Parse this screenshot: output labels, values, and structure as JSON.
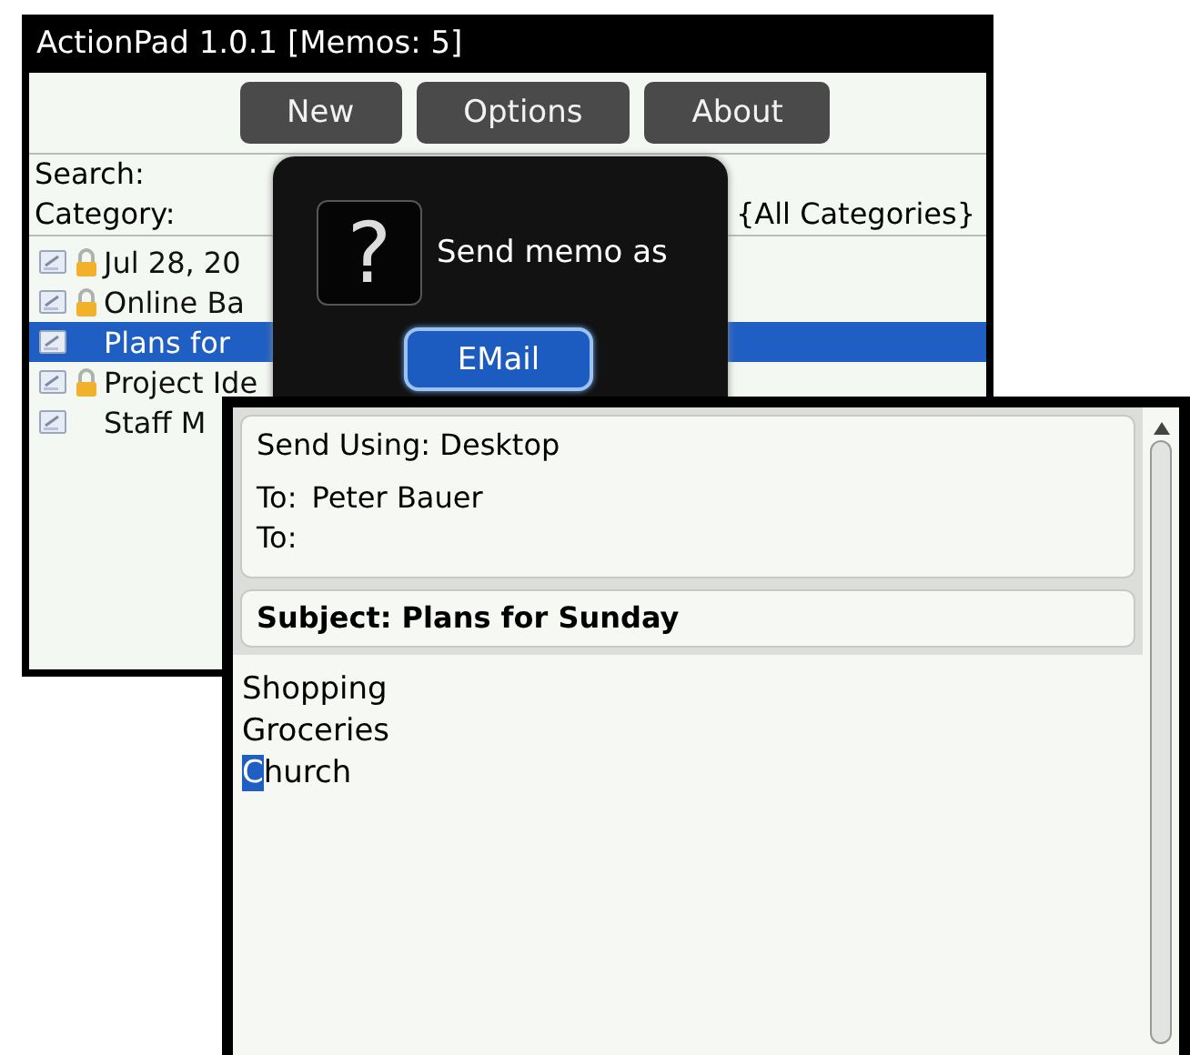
{
  "back_window": {
    "title": "ActionPad 1.0.1 [Memos: 5]",
    "buttons": [
      "New",
      "Options",
      "About"
    ],
    "search_label": "Search:",
    "category_label": "Category:",
    "category_value": "{All Categories}",
    "memos": [
      {
        "title": "Jul 28, 20",
        "locked": true,
        "selected": false
      },
      {
        "title": "Online Ba",
        "locked": true,
        "selected": false
      },
      {
        "title": "Plans for",
        "locked": false,
        "selected": true
      },
      {
        "title": "Project Ide",
        "locked": true,
        "selected": false
      },
      {
        "title": "Staff M",
        "locked": false,
        "selected": false
      }
    ]
  },
  "dialog": {
    "icon": "?",
    "message": "Send memo as",
    "buttons": [
      {
        "label": "EMail",
        "selected": true
      }
    ]
  },
  "front_window": {
    "send_using": "Send Using: Desktop",
    "recipients": [
      {
        "label": "To:",
        "value": "Peter Bauer"
      },
      {
        "label": "To:"
      }
    ],
    "subject": "Subject: Plans for Sunday",
    "body": [
      {
        "text": "Shopping",
        "cursor": false
      },
      {
        "text": "Groceries",
        "cursor": false
      },
      {
        "text": "Church",
        "cursor": true
      }
    ]
  }
}
